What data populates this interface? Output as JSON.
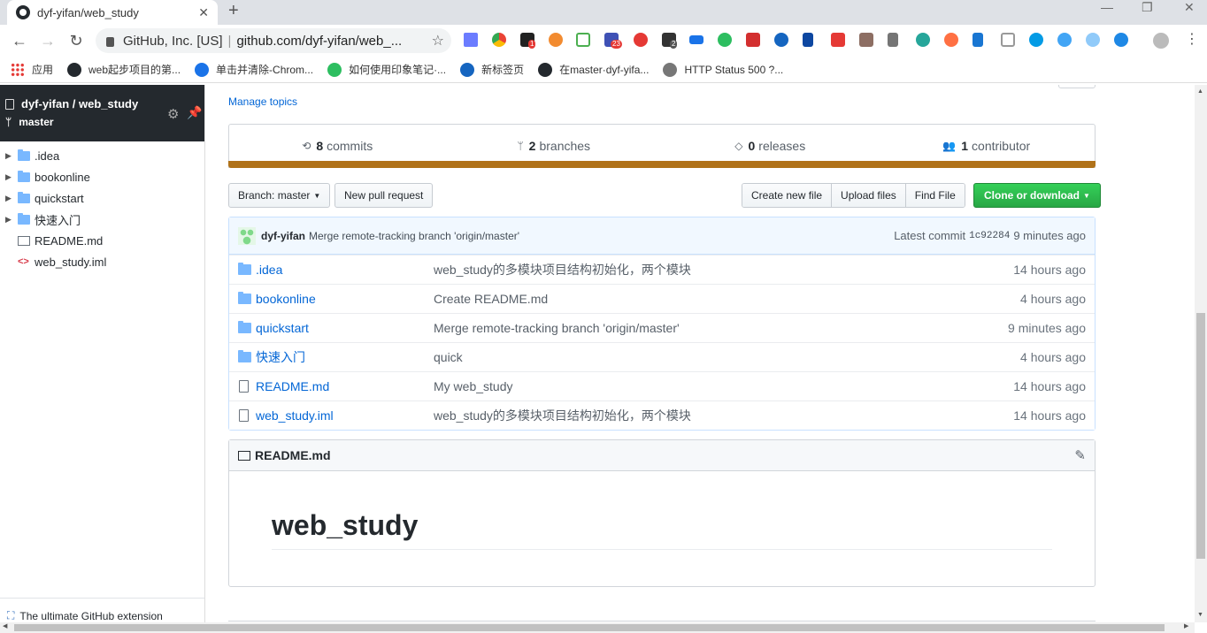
{
  "browser": {
    "tab_title": "dyf-yifan/web_study",
    "tab_close": "✕",
    "new_tab": "+",
    "omnibox_org": "GitHub, Inc. [US]",
    "omnibox_url": "github.com/dyf-yifan/web_...",
    "bookmarks": [
      {
        "label": "应用",
        "icon": "apps-grid-icon"
      },
      {
        "label": "web起步项目的第...",
        "icon": "github-icon"
      },
      {
        "label": "单击并清除-Chrom...",
        "icon": "extension-icon"
      },
      {
        "label": "如何使用印象笔记·...",
        "icon": "evernote-icon"
      },
      {
        "label": "新标签页",
        "icon": "bank-icon"
      },
      {
        "label": "在master·dyf-yifa...",
        "icon": "github-icon"
      },
      {
        "label": "HTTP Status 500 ?...",
        "icon": "globe-icon"
      }
    ],
    "extension_badges": {
      "b1": "1",
      "b2": "23",
      "b3": "2"
    }
  },
  "sidebar": {
    "repo": "dyf-yifan / web_study",
    "branch": "master",
    "tree": [
      {
        "label": ".idea",
        "kind": "folder"
      },
      {
        "label": "bookonline",
        "kind": "folder"
      },
      {
        "label": "quickstart",
        "kind": "folder"
      },
      {
        "label": "快速入门",
        "kind": "folder"
      },
      {
        "label": "README.md",
        "kind": "readme"
      },
      {
        "label": "web_study.iml",
        "kind": "code"
      }
    ],
    "footer": "The ultimate GitHub extension"
  },
  "repo": {
    "manage_topics": "Manage topics",
    "stats": {
      "commits_count": "8",
      "commits_label": "commits",
      "branches_count": "2",
      "branches_label": "branches",
      "releases_count": "0",
      "releases_label": "releases",
      "contributors_count": "1",
      "contributors_label": "contributor"
    },
    "language_color": "#b07219",
    "buttons": {
      "branch": "Branch: master",
      "new_pull_request": "New pull request",
      "create_new_file": "Create new file",
      "upload_files": "Upload files",
      "find_file": "Find File",
      "clone": "Clone or download"
    },
    "latest_commit": {
      "author": "dyf-yifan",
      "message": "Merge remote-tracking branch 'origin/master'",
      "label": "Latest commit",
      "sha": "1c92284",
      "time": "9 minutes ago"
    },
    "files": [
      {
        "name": ".idea",
        "kind": "folder",
        "message": "web_study的多模块项目结构初始化，两个模块",
        "age": "14 hours ago"
      },
      {
        "name": "bookonline",
        "kind": "folder",
        "message": "Create README.md",
        "age": "4 hours ago"
      },
      {
        "name": "quickstart",
        "kind": "folder",
        "message": "Merge remote-tracking branch 'origin/master'",
        "age": "9 minutes ago"
      },
      {
        "name": "快速入门",
        "kind": "folder",
        "message": "quick",
        "age": "4 hours ago"
      },
      {
        "name": "README.md",
        "kind": "file",
        "message": "My web_study",
        "age": "14 hours ago"
      },
      {
        "name": "web_study.iml",
        "kind": "file",
        "message": "web_study的多模块项目结构初始化，两个模块",
        "age": "14 hours ago"
      }
    ],
    "readme": {
      "title": "README.md",
      "heading": "web_study"
    }
  }
}
